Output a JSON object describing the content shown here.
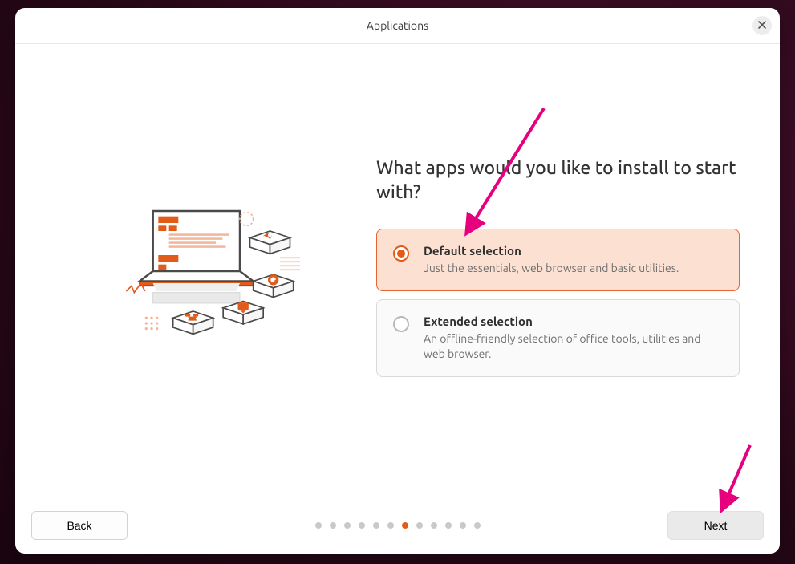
{
  "header": {
    "title": "Applications"
  },
  "question": "What apps would you like to install to start with?",
  "options": [
    {
      "title": "Default selection",
      "desc": "Just the essentials, web browser and basic utilities.",
      "selected": true
    },
    {
      "title": "Extended selection",
      "desc": "An offline-friendly selection of office tools, utilities and web browser.",
      "selected": false
    }
  ],
  "buttons": {
    "back": "Back",
    "next": "Next"
  },
  "pagination": {
    "total": 12,
    "current": 6
  },
  "colors": {
    "accent": "#e35b19",
    "selected_bg": "#fce1d2"
  }
}
